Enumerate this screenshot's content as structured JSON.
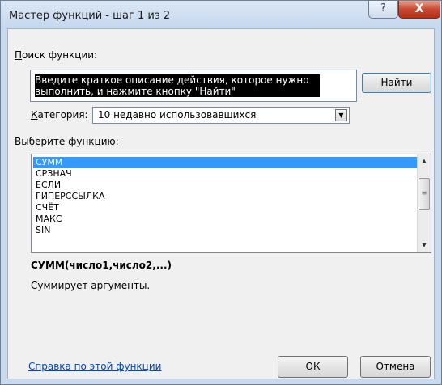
{
  "window": {
    "title": "Мастер функций - шаг 1 из 2",
    "help_button": "?",
    "close_button": "X"
  },
  "search": {
    "label_accel": "П",
    "label_rest": "оиск функции:",
    "field_value": "Введите краткое описание действия, которое нужно выполнить, и нажмите кнопку \"Найти\"",
    "find_accel": "Н",
    "find_rest": "айти"
  },
  "category": {
    "label_accel": "К",
    "label_rest": "атегория:",
    "selected": "10 недавно использовавшихся"
  },
  "functions": {
    "label_prefix": "Выберите ",
    "label_accel": "ф",
    "label_rest": "ункцию:",
    "items": [
      "СУММ",
      "СРЗНАЧ",
      "ЕСЛИ",
      "ГИПЕРССЫЛКА",
      "СЧЁТ",
      "МАКС",
      "SIN"
    ],
    "selected_index": 0
  },
  "selected_function": {
    "signature": "СУММ(число1,число2,...)",
    "description": "Суммирует аргументы."
  },
  "footer": {
    "help_link": "Справка по этой функции",
    "ok_label": "ОК",
    "cancel_label": "Отмена"
  },
  "colors": {
    "selection": "#3399ff",
    "link": "#0047c0",
    "close_button": "#c7492f"
  }
}
